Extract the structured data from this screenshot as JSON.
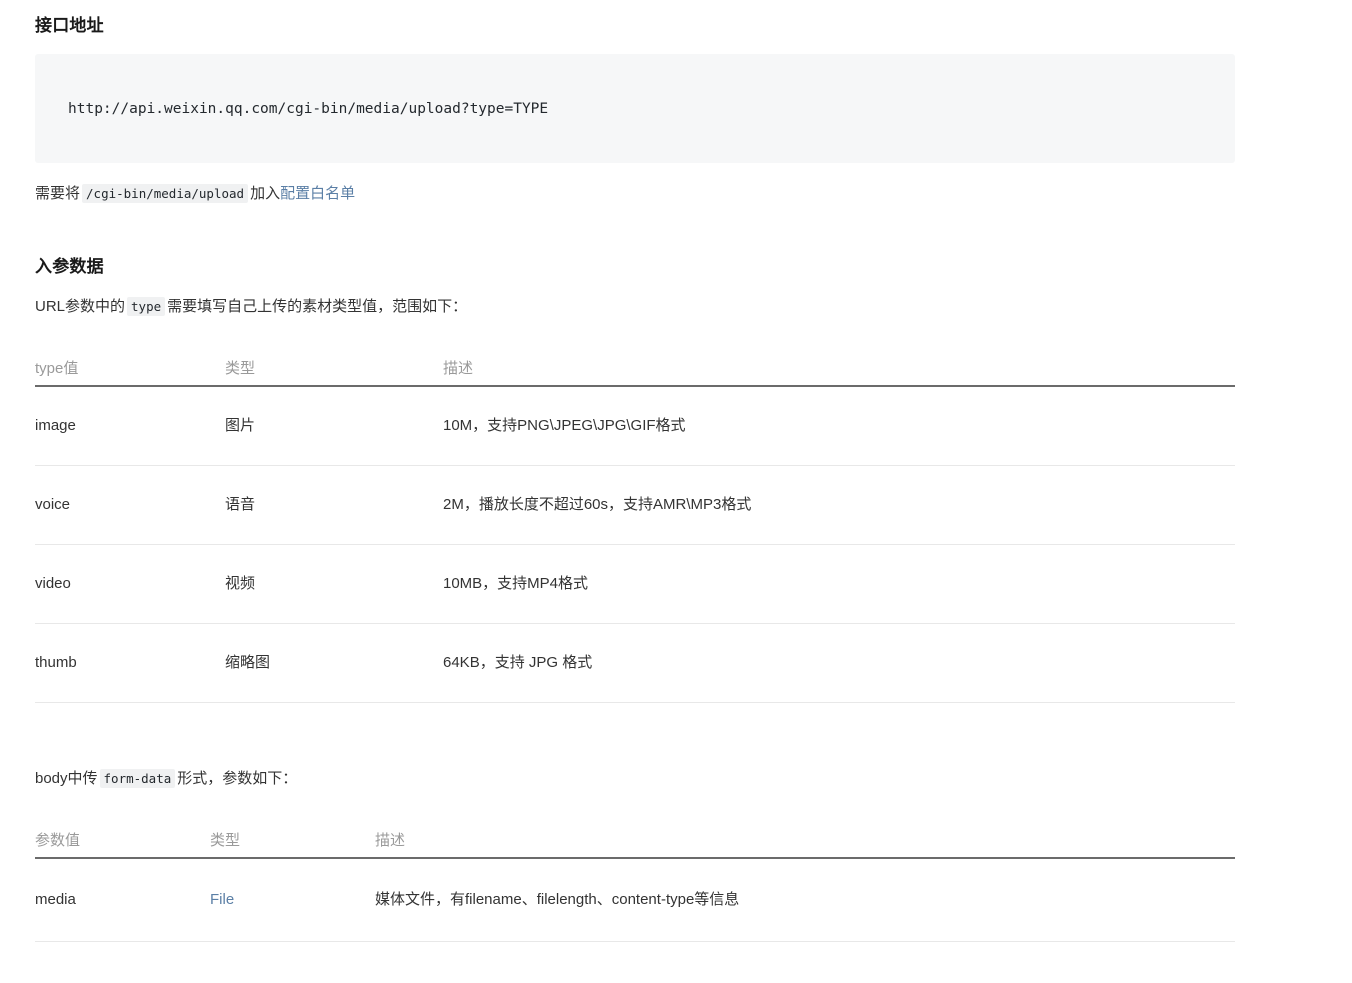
{
  "sections": {
    "api_address": {
      "heading": "接口地址",
      "code": "http://api.weixin.qq.com/cgi-bin/media/upload?type=TYPE",
      "note": {
        "prefix": "需要将",
        "code": "/cgi-bin/media/upload",
        "middle": "加入",
        "link": "配置白名单"
      }
    },
    "request_params": {
      "heading": "入参数据",
      "intro": {
        "prefix": "URL参数中的",
        "code": "type",
        "suffix": "需要填写自己上传的素材类型值，范围如下："
      },
      "type_table": {
        "headers": [
          "type值",
          "类型",
          "描述"
        ],
        "rows": [
          [
            "image",
            "图片",
            "10M，支持PNG\\JPEG\\JPG\\GIF格式"
          ],
          [
            "voice",
            "语音",
            "2M，播放长度不超过60s，支持AMR\\MP3格式"
          ],
          [
            "video",
            "视频",
            "10MB，支持MP4格式"
          ],
          [
            "thumb",
            "缩略图",
            "64KB，支持 JPG 格式"
          ]
        ]
      },
      "body_intro": {
        "prefix": "body中传",
        "code": "form-data",
        "suffix": "形式，参数如下："
      },
      "param_table": {
        "headers": [
          "参数值",
          "类型",
          "描述"
        ],
        "rows": [
          [
            "media",
            "File",
            "媒体文件，有filename、filelength、content-type等信息"
          ]
        ]
      }
    }
  },
  "colors": {
    "link": "#5b7fa6",
    "header_text": "#9a9a9a",
    "body_text": "#333333",
    "code_bg": "#f6f7f8",
    "rule_strong": "#6b6b6b",
    "rule_light": "#e8e8e8"
  }
}
